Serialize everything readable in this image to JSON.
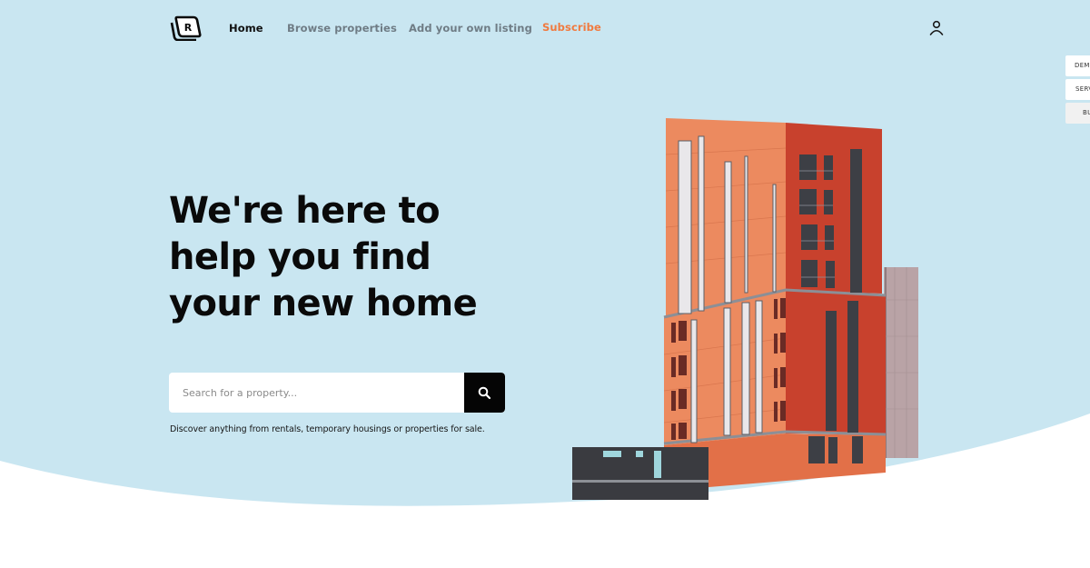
{
  "colors": {
    "hero_bg": "#c9e6f1",
    "accent": "#f07a3f",
    "text_dark": "#0a0a0a",
    "nav_muted": "#6f7c85"
  },
  "nav": {
    "logo_icon": "r-stacked-logo-icon",
    "links": [
      {
        "label": "Home",
        "active": true
      },
      {
        "label": "Browse properties",
        "active": false
      },
      {
        "label": "Add your own listing",
        "active": false
      },
      {
        "label": "Subscribe",
        "accent": true
      }
    ],
    "user_icon": "user-icon"
  },
  "side_tabs": [
    {
      "label": "DEMO"
    },
    {
      "label": "SERVICES"
    },
    {
      "label": "BUY"
    }
  ],
  "hero": {
    "headline_lines": [
      "We're here to",
      "help you find",
      "your new home"
    ],
    "search": {
      "placeholder": "Search for a property...",
      "value": "",
      "button_icon": "search-icon"
    },
    "subtext": "Discover anything from rentals, temporary housings or properties for sale.",
    "image_alt": "building-illustration"
  }
}
